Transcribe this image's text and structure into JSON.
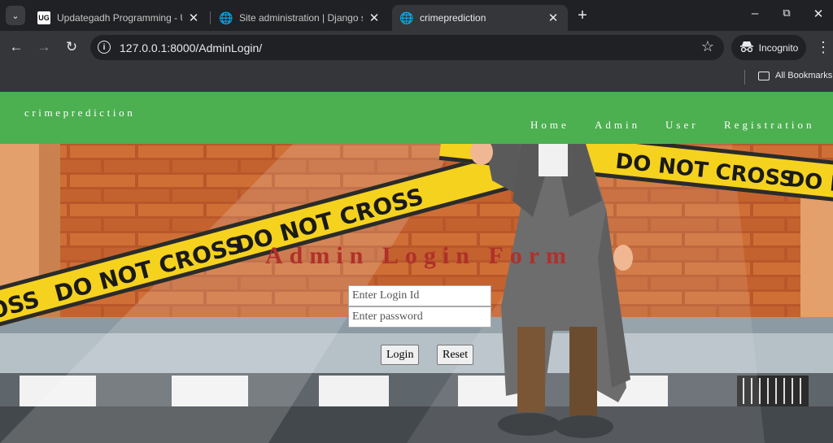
{
  "browser": {
    "tabs": [
      {
        "title": "Updategadh Programming - Upda",
        "favicon": "UG"
      },
      {
        "title": "Site administration | Django site a",
        "favicon": "globe-icon"
      },
      {
        "title": "crimeprediction",
        "favicon": "globe-icon",
        "active": true
      }
    ],
    "url": "127.0.0.1:8000/AdminLogin/",
    "profile_label": "Incognito",
    "bookmarks_label": "All Bookmarks"
  },
  "site": {
    "brand": "crimeprediction",
    "nav": [
      "Home",
      "Admin",
      "User",
      "Registration"
    ],
    "accent_color": "#4caf50"
  },
  "hero": {
    "tape_text": "DO NOT CROSS",
    "tape_fragment_left": "ROSS",
    "tape_fragment_right": "DO N"
  },
  "form": {
    "title": "Admin Login Form",
    "title_color": "#b0302a",
    "login_placeholder": "Enter Login Id",
    "password_placeholder": "Enter password",
    "login_button": "Login",
    "reset_button": "Reset"
  }
}
